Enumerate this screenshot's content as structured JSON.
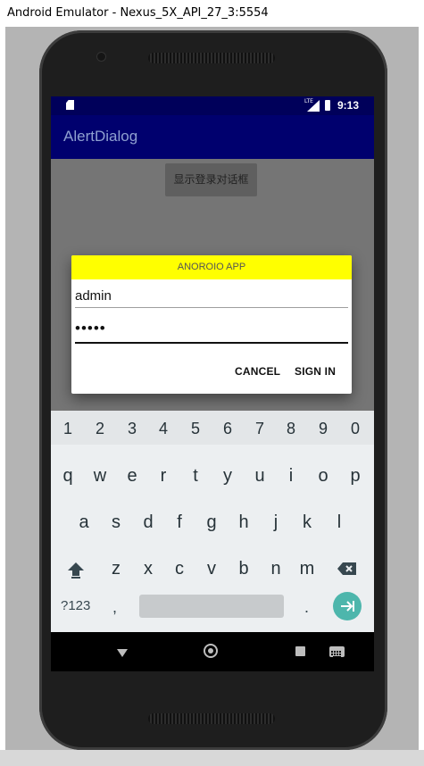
{
  "window": {
    "title": "Android Emulator - Nexus_5X_API_27_3:5554"
  },
  "status_bar": {
    "time": "9:13",
    "signal_label": "LTE"
  },
  "app_bar": {
    "title": "AlertDialog"
  },
  "main": {
    "show_dialog_button": "显示登录对话框"
  },
  "dialog": {
    "title": "ANOROIO APP",
    "username_value": "admin",
    "password_masked": "•••••",
    "cancel_label": "CANCEL",
    "sign_in_label": "SIGN IN"
  },
  "keyboard": {
    "number_row": [
      "1",
      "2",
      "3",
      "4",
      "5",
      "6",
      "7",
      "8",
      "9",
      "0"
    ],
    "row1": [
      "q",
      "w",
      "e",
      "r",
      "t",
      "y",
      "u",
      "i",
      "o",
      "p"
    ],
    "row2": [
      "a",
      "s",
      "d",
      "f",
      "g",
      "h",
      "j",
      "k",
      "l"
    ],
    "row3": [
      "z",
      "x",
      "c",
      "v",
      "b",
      "n",
      "m"
    ],
    "symbols_label": "?123",
    "comma_label": ",",
    "period_label": ".",
    "icons": [
      "shift-icon",
      "backspace-icon",
      "enter-icon"
    ]
  },
  "nav_bar": {
    "icons": [
      "back-icon",
      "home-icon",
      "recents-icon",
      "keyboard-switch-icon"
    ]
  },
  "colors": {
    "status_bar": "#00005a",
    "app_bar": "#00006e",
    "dialog_title_bg": "#ffff00",
    "enter_key": "#4db6ac",
    "keyboard_bg": "#eceff1"
  }
}
